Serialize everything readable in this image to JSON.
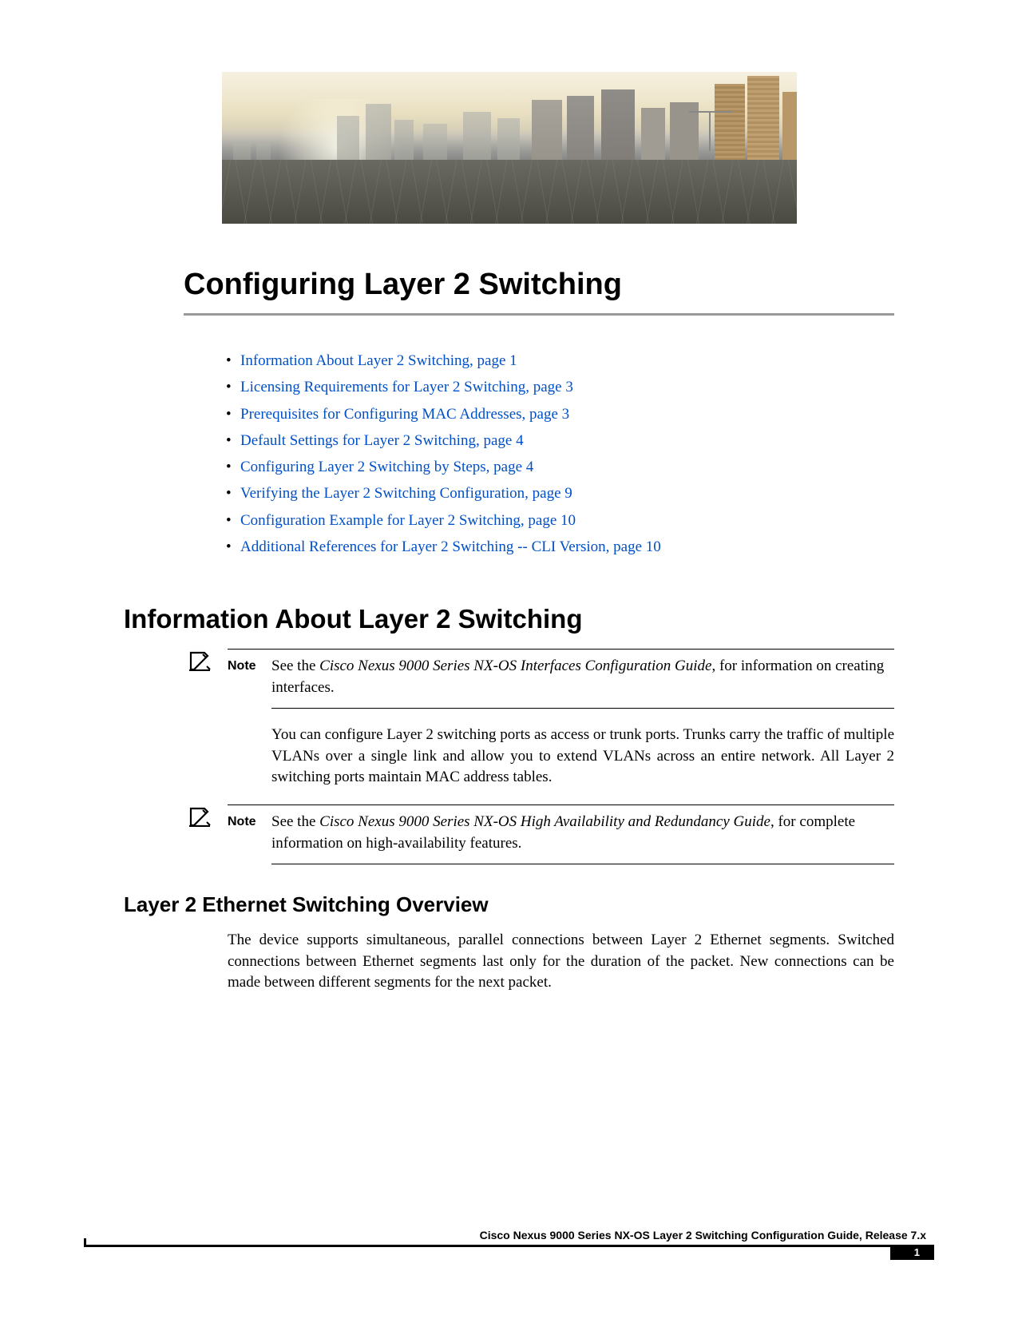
{
  "chapter_title": "Configuring Layer 2 Switching",
  "toc": [
    {
      "text": "Information About Layer 2 Switching,  page  1"
    },
    {
      "text": "Licensing Requirements for Layer 2 Switching,  page  3"
    },
    {
      "text": "Prerequisites for Configuring MAC Addresses,  page  3"
    },
    {
      "text": "Default Settings for Layer 2 Switching,  page  4"
    },
    {
      "text": "Configuring Layer 2 Switching by Steps,  page  4"
    },
    {
      "text": "Verifying the Layer 2 Switching Configuration,  page  9"
    },
    {
      "text": "Configuration Example for Layer 2 Switching,  page  10"
    },
    {
      "text": "Additional References for Layer 2 Switching -- CLI Version,  page  10"
    }
  ],
  "section1_title": "Information About Layer 2 Switching",
  "note_label": "Note",
  "note1_pre": "See the ",
  "note1_em": "Cisco Nexus 9000 Series NX-OS Interfaces Configuration Guide",
  "note1_post": ", for information on creating interfaces.",
  "para1": "You can configure Layer 2 switching ports as access or trunk ports. Trunks carry the traffic of multiple VLANs over a single link and allow you to extend VLANs across an entire network. All Layer 2 switching ports maintain MAC address tables.",
  "note2_pre": "See the  ",
  "note2_em": "Cisco Nexus 9000 Series NX-OS High Availability and Redundancy Guide",
  "note2_post": ", for complete information on high-availability features.",
  "section2_title": "Layer 2 Ethernet Switching Overview",
  "para2": "The device supports simultaneous, parallel connections between Layer 2 Ethernet segments. Switched connections between Ethernet segments last only for the duration of the packet. New connections can be made between different segments for the next packet.",
  "footer_text": "Cisco Nexus 9000 Series NX-OS Layer 2 Switching Configuration Guide, Release 7.x",
  "page_number": "1"
}
